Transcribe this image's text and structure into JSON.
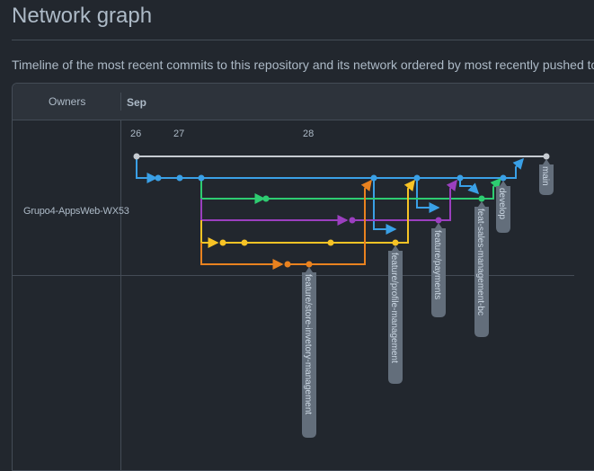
{
  "page": {
    "title": "Network graph",
    "description": "Timeline of the most recent commits to this repository and its network ordered by most recently pushed to."
  },
  "graph": {
    "owners_header": "Owners",
    "month": "Sep",
    "days": [
      "26",
      "27",
      "28"
    ],
    "owner": "Grupo4-AppsWeb-WX53",
    "branch_labels": [
      "main",
      "develop",
      "feat-sales-management-bc",
      "feature/payments",
      "feature/profile-management",
      "feature/store-invetory-management"
    ],
    "colors": {
      "main": "#c6cbd1",
      "develop": "#3aa0e6",
      "feat-sales-management-bc": "#2ecc71",
      "feature/payments": "#9b3fbf",
      "feature/profile-management": "#f7c325",
      "feature/store-invetory-management": "#e9821f",
      "label_bg": "#636e7b"
    }
  }
}
